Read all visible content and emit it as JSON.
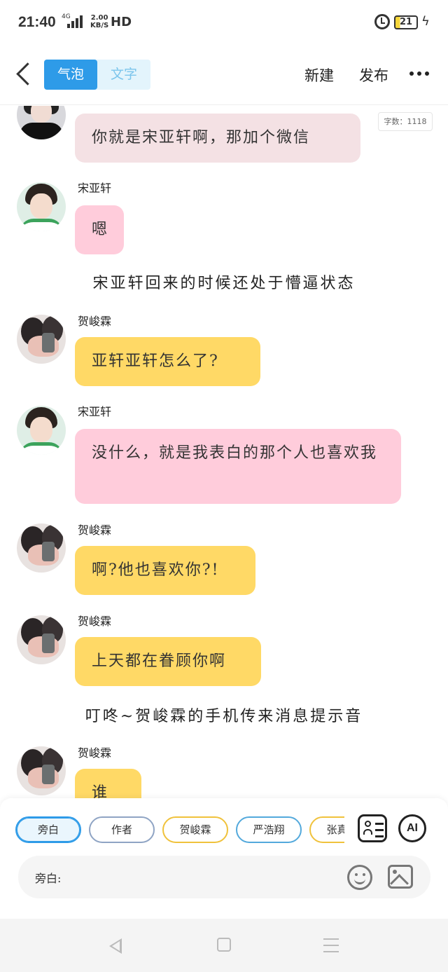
{
  "status": {
    "time": "21:40",
    "network": "4G",
    "speed_value": "2.00",
    "speed_unit": "KB/S",
    "hd": "HD",
    "battery": "21"
  },
  "header": {
    "tabs": [
      {
        "label": "气泡",
        "active": true
      },
      {
        "label": "文字",
        "active": false
      }
    ],
    "new_label": "新建",
    "publish_label": "发布"
  },
  "word_count": "字数：1118",
  "messages": [
    {
      "kind": "bubble",
      "speaker": "",
      "text": "你就是宋亚轩啊，那加个微信",
      "color": "#f4e1e4"
    },
    {
      "kind": "bubble",
      "speaker": "宋亚轩",
      "text": "嗯",
      "color": "#ffccdb"
    },
    {
      "kind": "narration",
      "text": "宋亚轩回来的时候还处于懵逼状态"
    },
    {
      "kind": "bubble",
      "speaker": "贺峻霖",
      "text": "亚轩亚轩怎么了?",
      "color": "#ffd966"
    },
    {
      "kind": "bubble",
      "speaker": "宋亚轩",
      "text": "没什么，就是我表白的那个人也喜欢我",
      "color": "#ffccdb"
    },
    {
      "kind": "bubble",
      "speaker": "贺峻霖",
      "text": "啊?他也喜欢你?!",
      "color": "#ffd966"
    },
    {
      "kind": "bubble",
      "speaker": "贺峻霖",
      "text": "上天都在眷顾你啊",
      "color": "#ffd966"
    },
    {
      "kind": "narration",
      "text": "叮咚~贺峻霖的手机传来消息提示音"
    },
    {
      "kind": "bubble",
      "speaker": "贺峻霖",
      "text": "谁啊",
      "color": "#ffd966"
    }
  ],
  "roles": [
    {
      "label": "旁白",
      "selected": true
    },
    {
      "label": "作者",
      "selected": false
    },
    {
      "label": "贺峻霖",
      "selected": false
    },
    {
      "label": "严浩翔",
      "selected": false
    },
    {
      "label": "张真源",
      "selected": false
    }
  ],
  "ai_label": "AI",
  "input": {
    "prefix": "旁白:",
    "value": ""
  },
  "colors": {
    "accent": "#2e9be8",
    "pink_bubble": "#ffccdb",
    "yellow_bubble": "#ffd966"
  }
}
